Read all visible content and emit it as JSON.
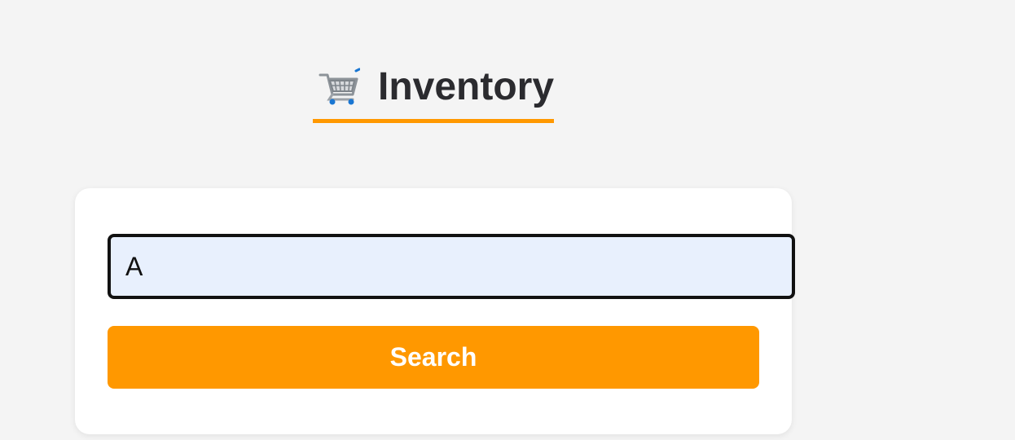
{
  "header": {
    "icon": "shopping-cart-icon",
    "title": "Inventory",
    "underline_color": "#ff9800"
  },
  "search": {
    "value": "A",
    "placeholder": "",
    "button_label": "Search"
  },
  "colors": {
    "background": "#f4f4f4",
    "card": "#ffffff",
    "accent": "#ff9800",
    "input_fill": "#e8f0fd",
    "text": "#2b2b2f"
  }
}
